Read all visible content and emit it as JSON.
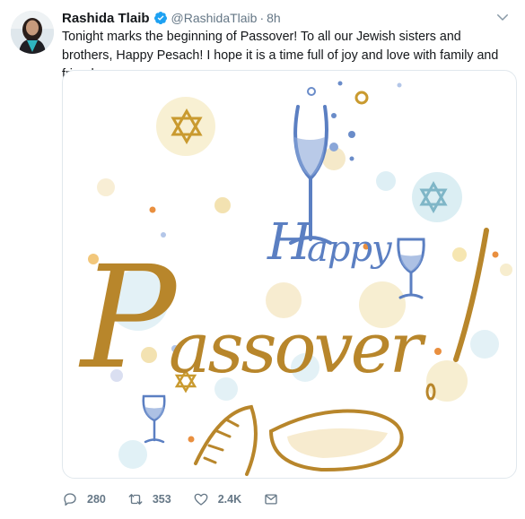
{
  "tweet": {
    "author_name": "Rashida Tlaib",
    "handle": "@RashidaTlaib",
    "separator": "·",
    "time": "8h",
    "text": "Tonight marks the beginning of Passover! To all our Jewish sisters and brothers, Happy Pesach! I hope it is a time full of joy and love with family and friends.",
    "image_text": "Happy Passover!"
  },
  "actions": {
    "replies": "280",
    "retweets": "353",
    "likes": "2.4K"
  },
  "colors": {
    "text": "#14171a",
    "secondary": "#657786",
    "verified": "#1da1f2",
    "border": "#e1e8ed",
    "passover_gold": "#b8862b",
    "happy_blue": "#5b7fc2"
  },
  "icons": [
    "avatar",
    "verified-badge-icon",
    "chevron-down-icon",
    "reply-icon",
    "retweet-icon",
    "like-icon",
    "direct-message-icon"
  ]
}
